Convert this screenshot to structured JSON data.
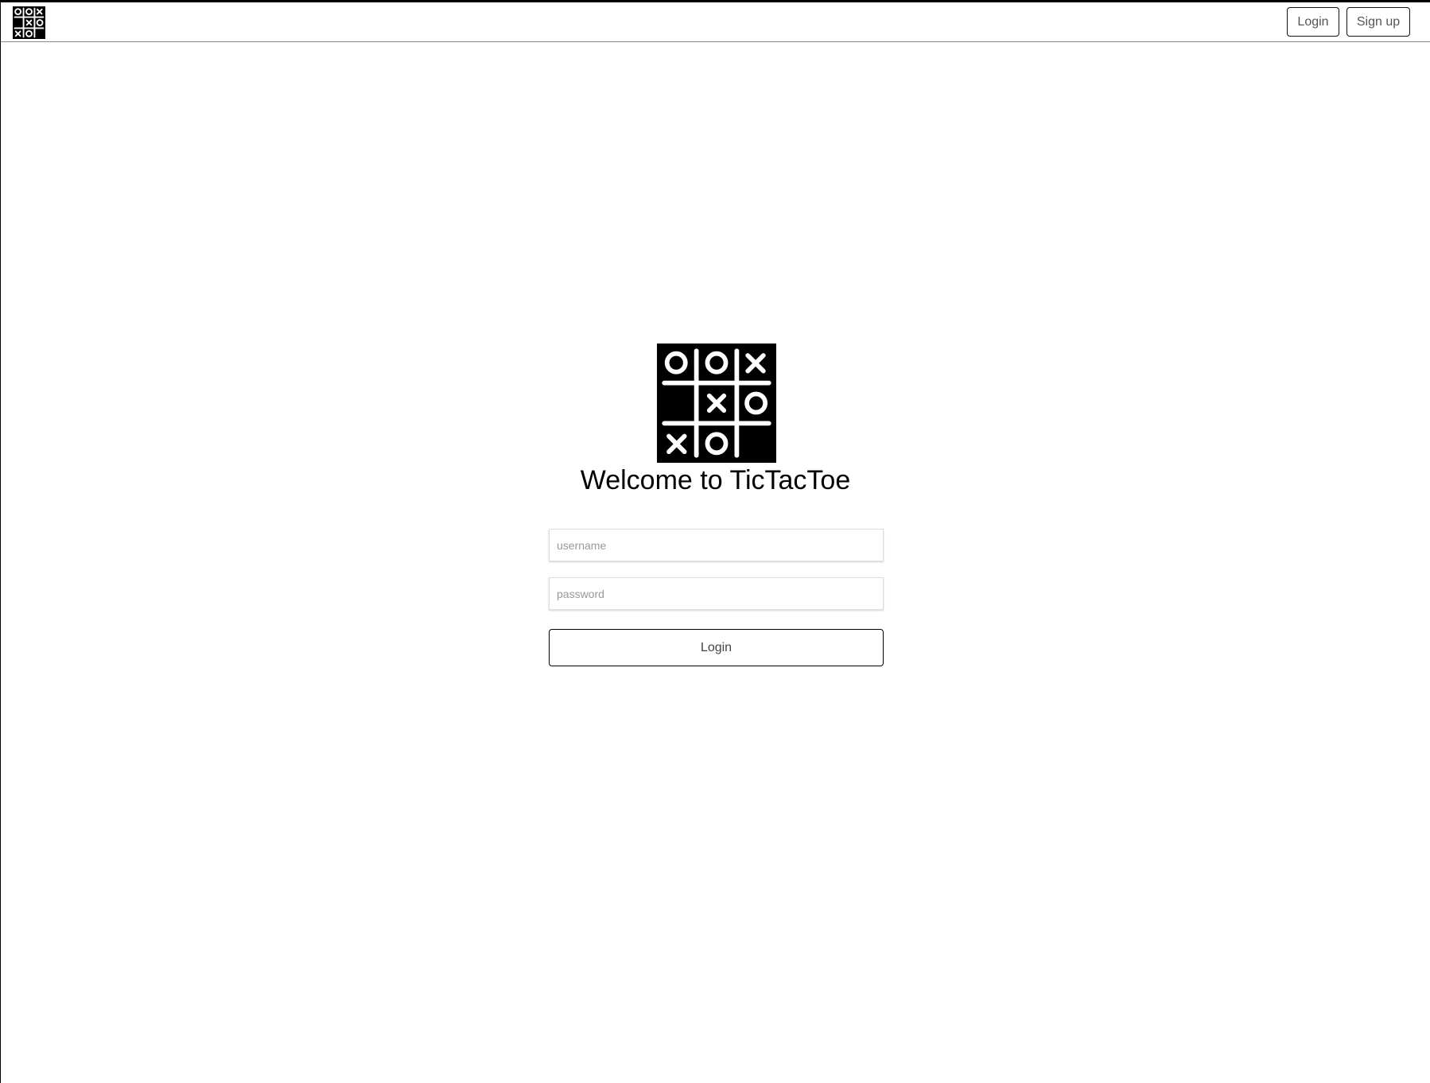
{
  "navbar": {
    "logo_icon": "tictactoe-logo-icon",
    "login_label": "Login",
    "signup_label": "Sign up"
  },
  "hero": {
    "logo_icon": "tictactoe-logo-icon",
    "title": "Welcome to TicTacToe"
  },
  "form": {
    "username_placeholder": "username",
    "username_value": "",
    "password_placeholder": "password",
    "password_value": "",
    "submit_label": "Login"
  },
  "colors": {
    "logo_background": "#000000",
    "logo_foreground": "#ffffff",
    "button_border": "#111111",
    "navbar_divider": "#8a8a8a"
  }
}
